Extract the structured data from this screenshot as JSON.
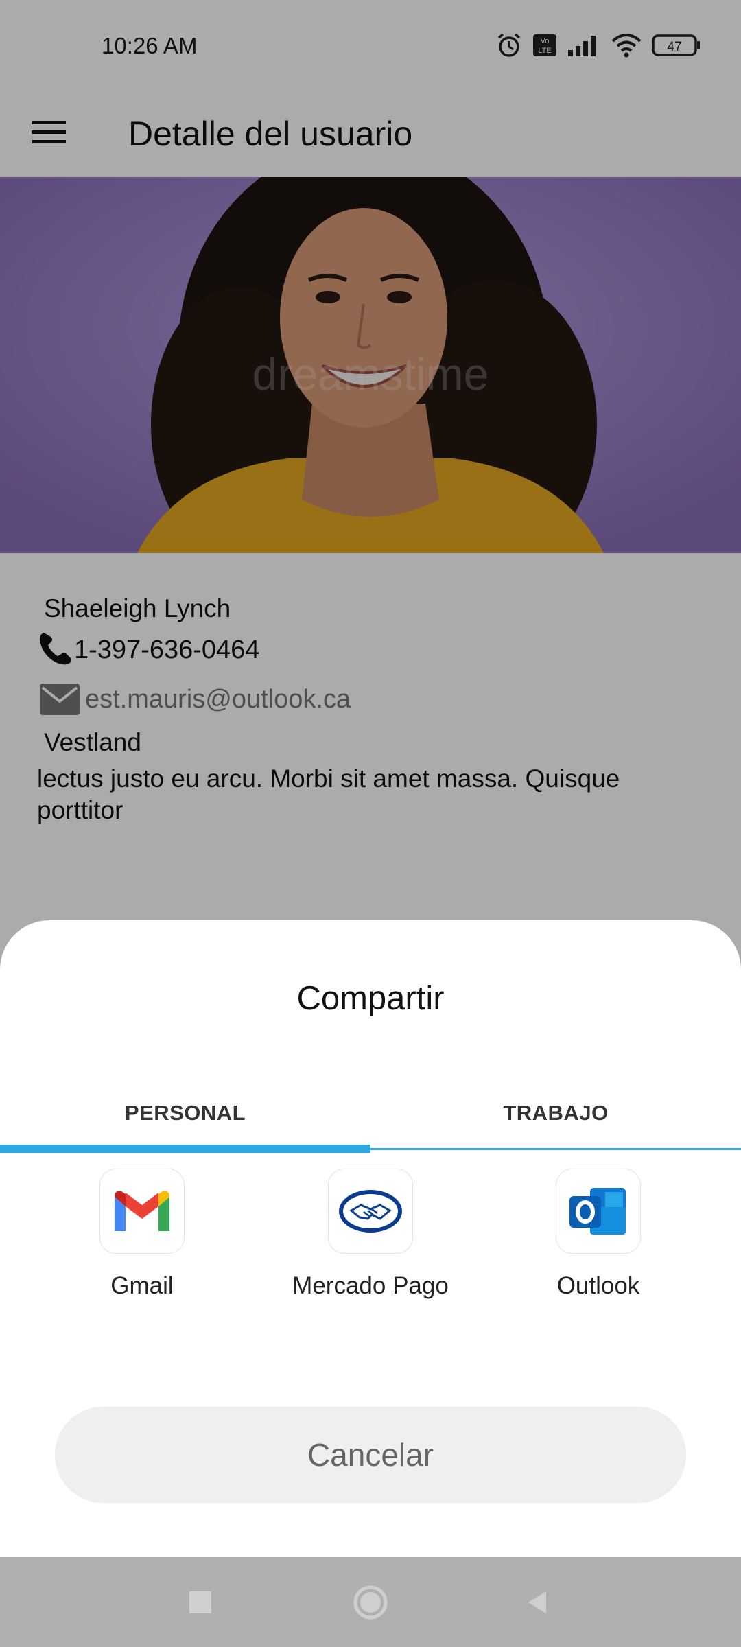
{
  "status_bar": {
    "time": "10:26 AM",
    "battery": "47",
    "icons": [
      "alarm-icon",
      "volte-icon",
      "signal-icon",
      "wifi-icon",
      "battery-icon"
    ]
  },
  "app_bar": {
    "title": "Detalle del usuario",
    "menu_icon": "hamburger-menu-icon"
  },
  "hero": {
    "watermark": "dreamstime"
  },
  "user": {
    "name": "Shaeleigh Lynch",
    "phone": "1-397-636-0464",
    "email": "est.mauris@outlook.ca",
    "city": "Vestland",
    "description": "lectus justo eu arcu. Morbi sit amet massa. Quisque porttitor"
  },
  "share_sheet": {
    "title": "Compartir",
    "tabs": [
      {
        "label": "PERSONAL",
        "selected": true
      },
      {
        "label": "TRABAJO",
        "selected": false
      }
    ],
    "apps": [
      {
        "label": "Gmail",
        "icon": "gmail-icon"
      },
      {
        "label": "Mercado Pago",
        "icon": "mercado-pago-icon"
      },
      {
        "label": "Outlook",
        "icon": "outlook-icon"
      }
    ],
    "cancel_label": "Cancelar"
  },
  "colors": {
    "tab_accent": "#2ea8e0",
    "hero_bg": "#9a80c8"
  }
}
